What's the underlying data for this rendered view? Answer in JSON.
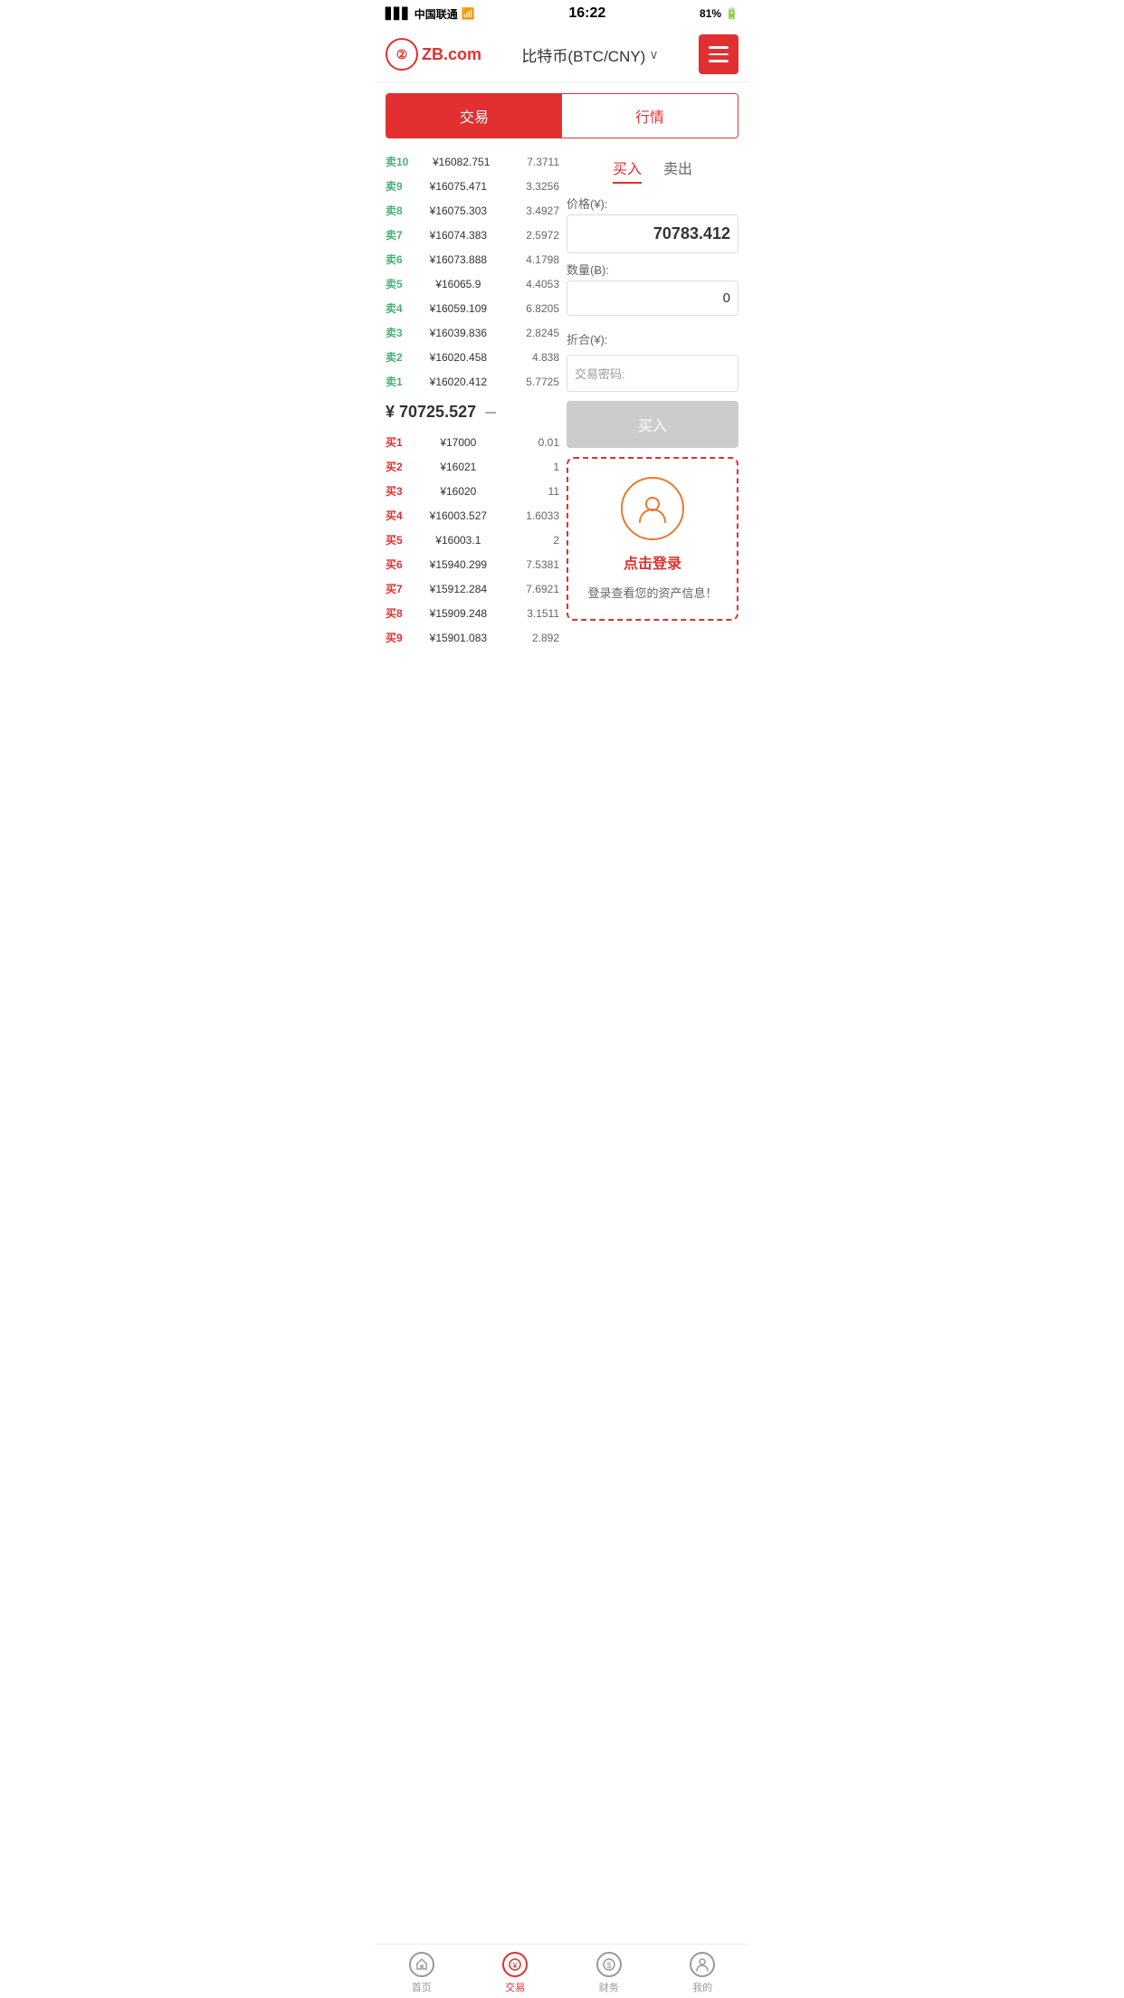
{
  "statusBar": {
    "carrier": "中国联通",
    "time": "16:22",
    "battery": "81%"
  },
  "header": {
    "logoText": "ZB.com",
    "title": "比特币(BTC/CNY)",
    "menuLabel": "menu"
  },
  "tabs": {
    "trade": "交易",
    "market": "行情"
  },
  "orderBook": {
    "sells": [
      {
        "label": "卖10",
        "price": "¥16082.751",
        "amount": "7.3711"
      },
      {
        "label": "卖9",
        "price": "¥16075.471",
        "amount": "3.3256"
      },
      {
        "label": "卖8",
        "price": "¥16075.303",
        "amount": "3.4927"
      },
      {
        "label": "卖7",
        "price": "¥16074.383",
        "amount": "2.5972"
      },
      {
        "label": "卖6",
        "price": "¥16073.888",
        "amount": "4.1798"
      },
      {
        "label": "卖5",
        "price": "¥16065.9",
        "amount": "4.4053"
      },
      {
        "label": "卖4",
        "price": "¥16059.109",
        "amount": "6.8205"
      },
      {
        "label": "卖3",
        "price": "¥16039.836",
        "amount": "2.8245"
      },
      {
        "label": "卖2",
        "price": "¥16020.458",
        "amount": "4.838"
      },
      {
        "label": "卖1",
        "price": "¥16020.412",
        "amount": "5.7725"
      }
    ],
    "currentPrice": "¥ 70725.527",
    "priceChangeSymbol": "－",
    "buys": [
      {
        "label": "买1",
        "price": "¥17000",
        "amount": "0.01"
      },
      {
        "label": "买2",
        "price": "¥16021",
        "amount": "1"
      },
      {
        "label": "买3",
        "price": "¥16020",
        "amount": "11"
      },
      {
        "label": "买4",
        "price": "¥16003.527",
        "amount": "1.6033"
      },
      {
        "label": "买5",
        "price": "¥16003.1",
        "amount": "2"
      },
      {
        "label": "买6",
        "price": "¥15940.299",
        "amount": "7.5381"
      },
      {
        "label": "买7",
        "price": "¥15912.284",
        "amount": "7.6921"
      },
      {
        "label": "买8",
        "price": "¥15909.248",
        "amount": "3.1511"
      },
      {
        "label": "买9",
        "price": "¥15901.083",
        "amount": "2.892"
      }
    ]
  },
  "tradePanel": {
    "buyTab": "买入",
    "sellTab": "卖出",
    "priceLabel": "价格(¥):",
    "priceValue": "70783.412",
    "amountLabel": "数量(Ƀ):",
    "amountValue": "0",
    "totalLabel": "折合(¥):",
    "passwordLabel": "交易密码:",
    "buyButton": "买入",
    "loginPromptText": "点击登录",
    "loginDesc": "登录查看您的资产信息！"
  },
  "bottomNav": {
    "items": [
      {
        "label": "首页",
        "icon": "star",
        "active": false
      },
      {
        "label": "交易",
        "icon": "trade",
        "active": true
      },
      {
        "label": "财务",
        "icon": "wallet",
        "active": false
      },
      {
        "label": "我的",
        "icon": "user",
        "active": false
      }
    ]
  }
}
